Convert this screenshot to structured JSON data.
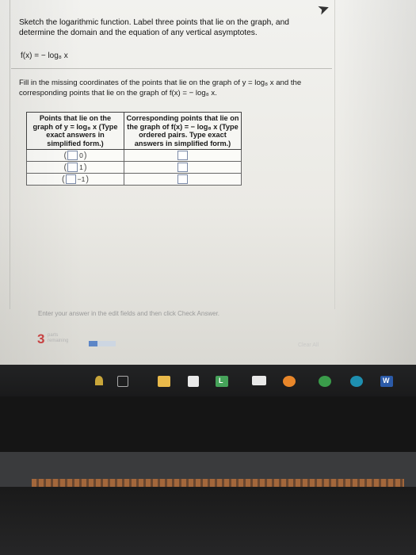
{
  "question": {
    "text": "Sketch the logarithmic function. Label three points that lie on the graph, and determine the domain and the equation of any vertical asymptotes.",
    "function": "f(x) = − log₈ x"
  },
  "instructions": {
    "text": "Fill in the missing coordinates of the points that lie on the graph of y = log₈ x and the corresponding points that lie on the graph of f(x) = − log₈ x."
  },
  "table": {
    "headers": [
      "Points that lie on the graph of y = log₈ x (Type exact answers in simplified form.)",
      "Corresponding points that lie on the graph of f(x) = − log₈ x (Type ordered pairs. Type exact answers in simplified form.)"
    ],
    "rows": [
      {
        "y_value": "0"
      },
      {
        "y_value": "1"
      },
      {
        "y_value": "−1"
      }
    ]
  },
  "footer": {
    "note": "Enter your answer in the edit fields and then click Check Answer.",
    "parts_count": "3",
    "parts_label": "parts remaining",
    "progress": 0.33,
    "clear_all": "Clear All"
  },
  "taskbar": {
    "app_l_letter": "L",
    "word_letter": "W"
  },
  "colors": {
    "accent": "#5d86c7",
    "parts_count": "#cc4444",
    "taskbar": "#1f2021"
  }
}
